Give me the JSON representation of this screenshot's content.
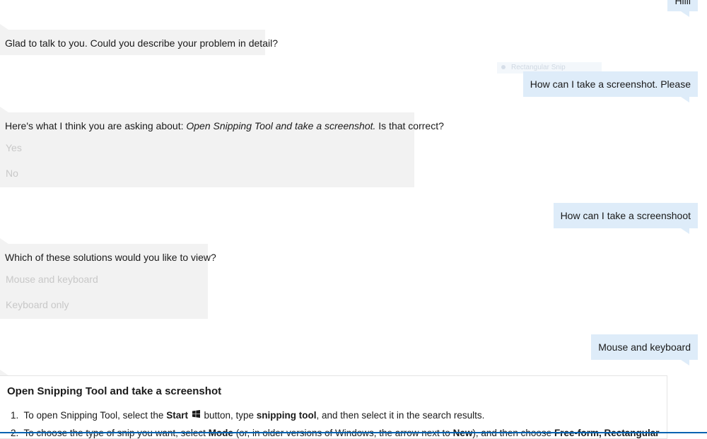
{
  "messages": {
    "user_hi": "Hiiii",
    "bot_greeting": "Glad to talk to you. Could you describe your problem in detail?",
    "ghost_label": "Rectangular Snip",
    "user_q1": "How can I take a screenshot. Please",
    "bot_confirm_prefix": "Here's what I think you are asking about: ",
    "bot_confirm_topic": "Open Snipping Tool and take a screenshot.",
    "bot_confirm_suffix": " Is that correct?",
    "confirm_options": [
      "Yes",
      "No"
    ],
    "user_q2": "How can I take a screenshoot",
    "bot_solutions": "Which of these solutions would you like to view?",
    "solution_options": [
      "Mouse and keyboard",
      "Keyboard only"
    ],
    "user_choice": "Mouse and keyboard"
  },
  "article": {
    "title": "Open Snipping Tool and take a screenshot",
    "step1": {
      "num": "1.",
      "t1": "To open Snipping Tool, select the ",
      "b1": "Start",
      "t2": " button, type ",
      "b2": "snipping tool",
      "t3": ", and then select it in the search results."
    },
    "step2": {
      "num": "2.",
      "t1": "To choose the type of snip you want, select ",
      "b1": "Mode",
      "t2": " (or, in older versions of Windows, the arrow next to ",
      "b2": "New",
      "t3": "), and then choose ",
      "b3": "Free-form, Rectangular"
    }
  },
  "colors": {
    "user_bubble": "#deecf9",
    "bot_bubble": "#f2f2f2",
    "choice_text": "#c8c8c8",
    "accent": "#0063b1"
  }
}
